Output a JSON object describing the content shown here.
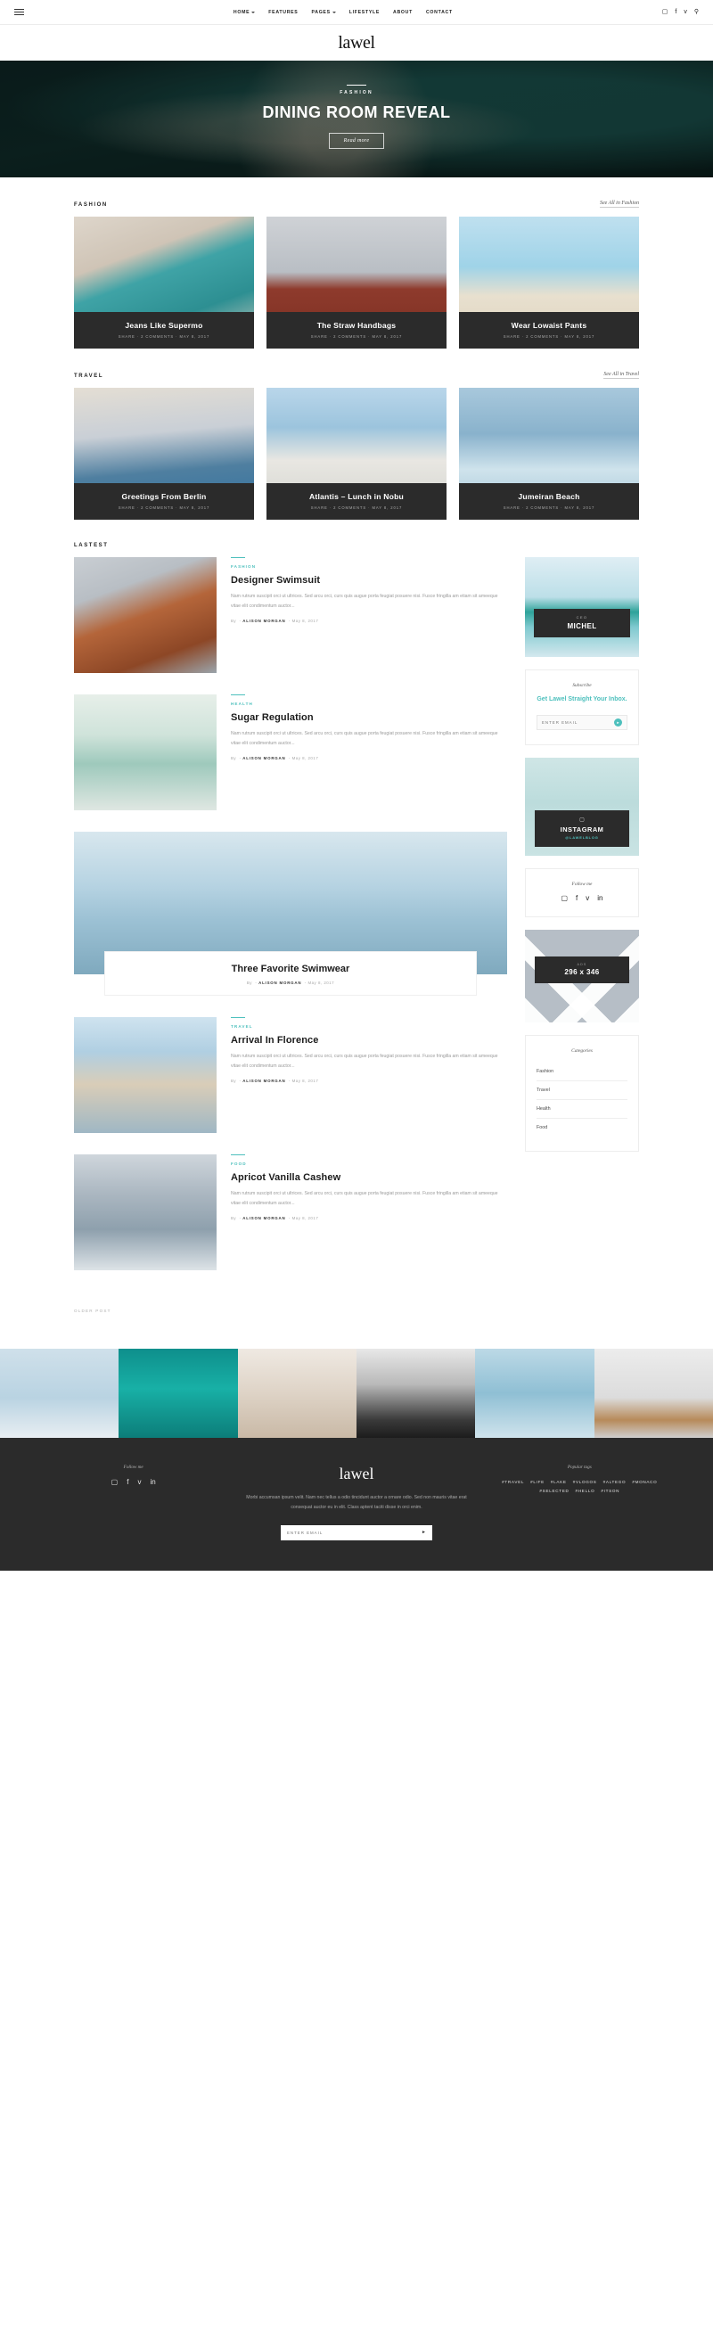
{
  "topbar": {
    "menu_icon": "hamburger-icon",
    "nav": [
      {
        "label": "HOME",
        "caret": true
      },
      {
        "label": "FEATURES",
        "caret": false
      },
      {
        "label": "PAGES",
        "caret": true
      },
      {
        "label": "LIFESTYLE",
        "caret": false
      },
      {
        "label": "ABOUT",
        "caret": false
      },
      {
        "label": "CONTACT",
        "caret": false
      }
    ],
    "social": [
      {
        "name": "instagram-icon",
        "glyph": "▢"
      },
      {
        "name": "facebook-icon",
        "glyph": "f"
      },
      {
        "name": "twitter-icon",
        "glyph": "ᴠ"
      },
      {
        "name": "search-icon",
        "glyph": "⚲"
      }
    ]
  },
  "brand": {
    "name": "lawel"
  },
  "hero": {
    "category": "FASHION",
    "title": "DINING ROOM REVEAL",
    "button": "Read more"
  },
  "sections": [
    {
      "title": "FASHION",
      "link": "See All in Fashion",
      "cards": [
        {
          "title": "Jeans Like Supermo",
          "meta": "SHARE  ·  2 COMMENTS  ·  MAY 8, 2017"
        },
        {
          "title": "The Straw Handbags",
          "meta": "SHARE  ·  2 COMMENTS  ·  MAY 8, 2017"
        },
        {
          "title": "Wear Lowaist Pants",
          "meta": "SHARE  ·  2 COMMENTS  ·  MAY 8, 2017"
        }
      ]
    },
    {
      "title": "TRAVEL",
      "link": "See All in Travel",
      "cards": [
        {
          "title": "Greetings From Berlin",
          "meta": "SHARE  ·  2 COMMENTS  ·  MAY 8, 2017"
        },
        {
          "title": "Atlantis – Lunch in Nobu",
          "meta": "SHARE  ·  2 COMMENTS  ·  MAY 8, 2017"
        },
        {
          "title": "Jumeiran Beach",
          "meta": "SHARE  ·  2 COMMENTS  ·  MAY 8, 2017"
        }
      ]
    }
  ],
  "latest": {
    "title": "LASTEST",
    "older_label": "OLDER POST",
    "posts": [
      {
        "category": "FASHION",
        "title": "Designer Swimsuit",
        "excerpt": "Nam rutrum suscipit orci ut ultrices. Sed arcu orci, curs quis augue porta feugiat posuere nisi. Fusce fringilla am etiam sit ameeque vitae elit condimentum auctor...",
        "by_prefix": "By",
        "author": "ALISON MORGAN",
        "date": "May 8, 2017"
      },
      {
        "category": "HEALTH",
        "title": "Sugar Regulation",
        "excerpt": "Nam rutrum suscipit orci ut ultrices. Sed arcu orci, curs quis augue porta feugiat posuere nisi. Fusce fringilla am etiam sit ameeque vitae elit condimentum auctor...",
        "by_prefix": "By",
        "author": "ALISON MORGAN",
        "date": "May 8, 2017"
      },
      {
        "category": "TRAVEL",
        "title": "Arrival In Florence",
        "excerpt": "Nam rutrum suscipit orci ut ultrices. Sed arcu orci, curs quis augue porta feugiat posuere nisi. Fusce fringilla am etiam sit ameeque vitae elit condimentum auctor...",
        "by_prefix": "By",
        "author": "ALISON MORGAN",
        "date": "May 8, 2017"
      },
      {
        "category": "FOOD",
        "title": "Apricot Vanilla Cashew",
        "excerpt": "Nam rutrum suscipit orci ut ultrices. Sed arcu orci, curs quis augue porta feugiat posuere nisi. Fusce fringilla am etiam sit ameeque vitae elit condimentum auctor...",
        "by_prefix": "By",
        "author": "ALISON MORGAN",
        "date": "May 8, 2017"
      }
    ],
    "feature": {
      "title": "Three Favorite Swimwear",
      "by_prefix": "By",
      "author": "ALISON MORGAN",
      "date": "May 8, 2017"
    }
  },
  "sidebar": {
    "author": {
      "role": "CEO",
      "name": "MICHEL"
    },
    "subscribe": {
      "label": "Subscribe",
      "headline": "Get Lawel Straight Your Inbox.",
      "placeholder": "ENTER EMAIL",
      "send_icon": "send-arrow-icon"
    },
    "instagram": {
      "icon": "instagram-icon",
      "name": "INSTAGRAM",
      "handle": "@LAWELBLOG"
    },
    "follow": {
      "label": "Follow me",
      "social": [
        {
          "name": "instagram-icon",
          "glyph": "▢"
        },
        {
          "name": "facebook-icon",
          "glyph": "f"
        },
        {
          "name": "twitter-icon",
          "glyph": "ᴠ"
        },
        {
          "name": "linkedin-icon",
          "glyph": "in"
        }
      ]
    },
    "ad": {
      "label": "ADS",
      "size": "296 x 346"
    },
    "categories": {
      "label": "Categories",
      "items": [
        "Fashion",
        "Travel",
        "Health",
        "Food"
      ]
    }
  },
  "footer": {
    "follow_label": "Follow me",
    "social": [
      {
        "name": "instagram-icon",
        "glyph": "▢"
      },
      {
        "name": "facebook-icon",
        "glyph": "f"
      },
      {
        "name": "twitter-icon",
        "glyph": "ᴠ"
      },
      {
        "name": "linkedin-icon",
        "glyph": "in"
      }
    ],
    "brand": "lawel",
    "about": "Morbi accumsan ipsum velit. Nam nec tellus a odio tincidunt auctor a ornare odio. Sed non mauris vitae erat consequat auctor eu in elit. Class aptent taciti disse in orci enim.",
    "email_placeholder": "ENTER EMAIL",
    "send_icon": "send-arrow-icon",
    "tags_label": "Popular tags",
    "tags": [
      "#TRAVEL",
      "#LIFE",
      "#LAKE",
      "#VLOGOS",
      "#ALTEGO",
      "#MONACO",
      "#SELECTED",
      "#HELLO",
      "#ITSON"
    ]
  },
  "colors": {
    "accent": "#4ec0bd",
    "dark": "#2b2b2b",
    "text": "#1c1c1c"
  }
}
